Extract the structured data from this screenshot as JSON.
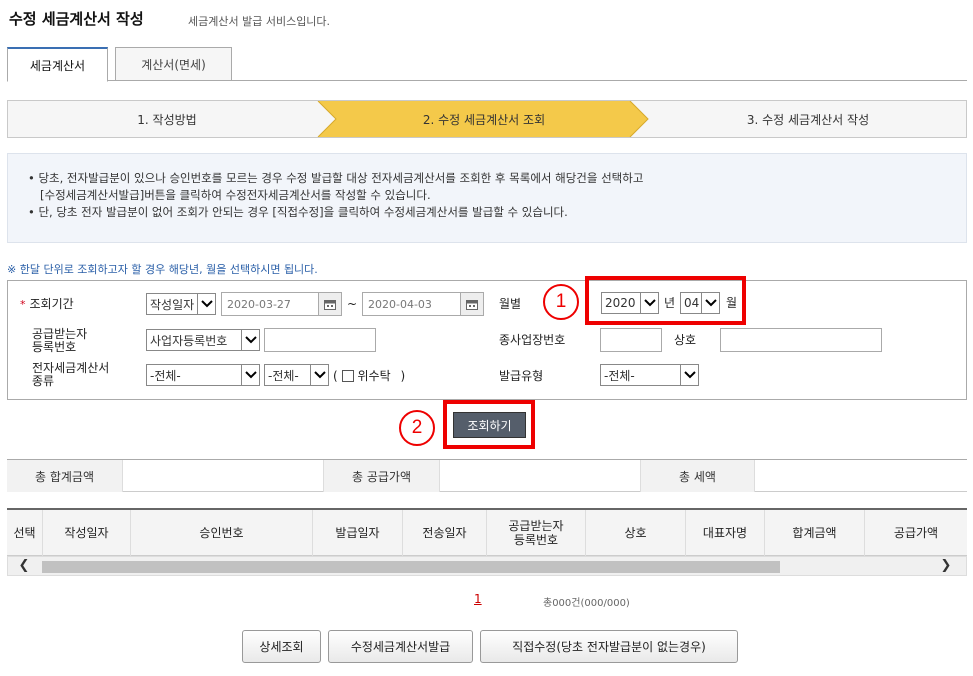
{
  "header": {
    "title": "수정 세금계산서 작성",
    "subtitle": "세금계산서 발급 서비스입니다."
  },
  "tabs": [
    {
      "label": "세금계산서",
      "active": true
    },
    {
      "label": "계산서(면세)",
      "active": false
    }
  ],
  "steps": [
    {
      "label": "1. 작성방법"
    },
    {
      "label": "2. 수정 세금계산서 조회",
      "active": true
    },
    {
      "label": "3. 수정 세금계산서 작성"
    }
  ],
  "info": {
    "line1": "• 당초, 전자발급분이 있으나 승인번호를 모르는 경우 수정 발급할 대상 전자세금계산서를 조회한 후 목록에서 해당건을 선택하고",
    "line2": "[수정세금계산서발급]버튼을 클릭하여 수정전자세금계산서를 작성할 수 있습니다.",
    "line3": "• 단, 당초 전자 발급분이 없어 조회가 안되는 경우 [직접수정]을 클릭하여 수정세금계산서를 발급할 수 있습니다."
  },
  "note": "※ 한달 단위로 조회하고자 할 경우 해당년, 월을 선택하시면 됩니다.",
  "search": {
    "required_mark": "*",
    "period_label": "조회기간",
    "date_type": "작성일자",
    "date_from": "2020-03-27",
    "tilde": "~",
    "date_to": "2020-04-03",
    "month_label": "월별",
    "year": "2020",
    "year_unit": "년",
    "month": "04",
    "month_unit": "월",
    "receiver_label_1": "공급받는자",
    "receiver_label_2": "등록번호",
    "receiver_type": "사업자등록번호",
    "sub_biz_label": "종사업장번호",
    "company_label": "상호",
    "kind_label_1": "전자세금계산서",
    "kind_label_2": "종류",
    "kind1": "-전체-",
    "kind2": "-전체-",
    "paren_open": "(",
    "consign_label": "위수탁",
    "paren_close": ")",
    "issue_type_label": "발급유형",
    "issue_type": "-전체-"
  },
  "markers": {
    "one": "1",
    "two": "2"
  },
  "search_button": "조회하기",
  "totals": {
    "total_label": "총 합계금액",
    "supply_label": "총 공급가액",
    "tax_label": "총 세액"
  },
  "grid": {
    "columns": [
      "선택",
      "작성일자",
      "승인번호",
      "발급일자",
      "전송일자",
      "공급받는자\n등록번호",
      "상호",
      "대표자명",
      "합계금액",
      "공급가액"
    ]
  },
  "scroll": {
    "left": "❮",
    "right": "❯"
  },
  "pager": {
    "page": "1",
    "count": "총000건(000/000)"
  },
  "buttons": {
    "detail": "상세조회",
    "issue": "수정세금계산서발급",
    "direct": "직접수정(당초 전자발급분이 없는경우)"
  },
  "icons": {
    "calendar": "calendar-icon",
    "dropdown": "chevron-down-icon"
  }
}
